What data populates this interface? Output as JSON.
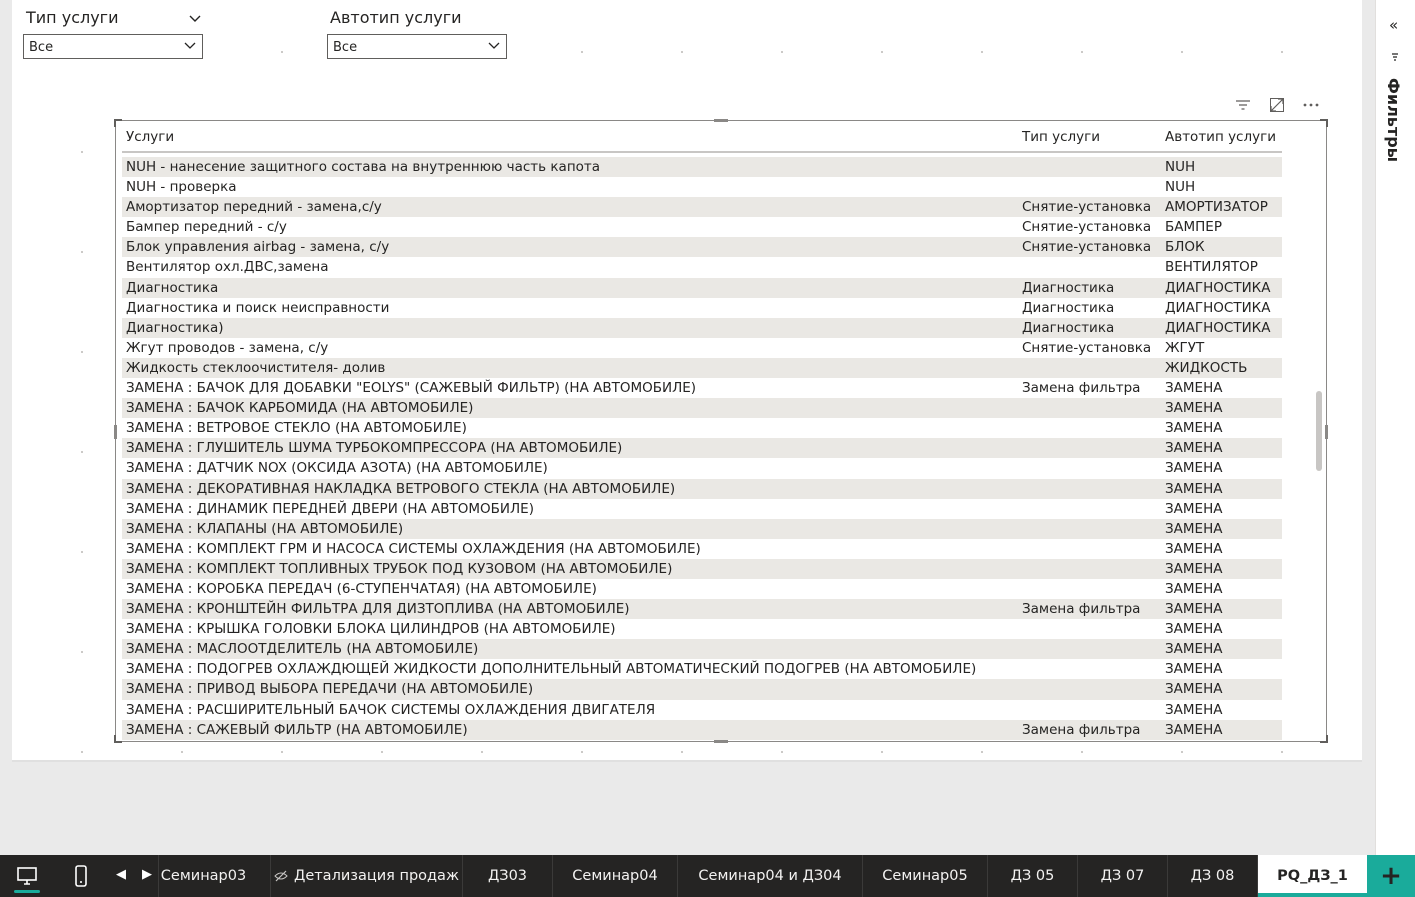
{
  "slicers": [
    {
      "title": "Тип услуги",
      "value": "Все"
    },
    {
      "title": "Автотип услуги",
      "value": "Все"
    }
  ],
  "table": {
    "headers": [
      "Услуги",
      "Тип услуги",
      "Автотип услуги"
    ],
    "rows": [
      [
        "NUH - нанесение защитного состава на внутреннюю часть капота",
        "",
        "NUH"
      ],
      [
        "NUH - проверка",
        "",
        "NUH"
      ],
      [
        "Амортизатор передний - замена,с/у",
        "Снятие-установка",
        "АМОРТИЗАТОР"
      ],
      [
        "Бампер передний - с/у",
        "Снятие-установка",
        "БАМПЕР"
      ],
      [
        "Блок управления airbag - замена, с/у",
        "Снятие-установка",
        "БЛОК"
      ],
      [
        "Вентилятор охл.ДВС,замена",
        "",
        "ВЕНТИЛЯТОР"
      ],
      [
        "Диагностика",
        "Диагностика",
        "ДИАГНОСТИКА"
      ],
      [
        "Диагностика и поиск неисправности",
        "Диагностика",
        "ДИАГНОСТИКА"
      ],
      [
        "Диагностика)",
        "Диагностика",
        "ДИАГНОСТИКА"
      ],
      [
        "Жгут проводов - замена, с/у",
        "Снятие-установка",
        "ЖГУТ"
      ],
      [
        "Жидкость стеклоочистителя- долив",
        "",
        "ЖИДКОСТЬ"
      ],
      [
        "ЗАМЕНА : БАЧОК ДЛЯ ДОБАВКИ \"EOLYS\" (САЖЕВЫЙ ФИЛЬТР) (НА АВТОМОБИЛЕ)",
        "Замена фильтра",
        "ЗАМЕНА"
      ],
      [
        "ЗАМЕНА : БАЧОК КАРБОМИДА (НА АВТОМОБИЛЕ)",
        "",
        "ЗАМЕНА"
      ],
      [
        "ЗАМЕНА : ВЕТРОВОЕ СТЕКЛО (НА АВТОМОБИЛЕ)",
        "",
        "ЗАМЕНА"
      ],
      [
        "ЗАМЕНА : ГЛУШИТЕЛЬ ШУМА ТУРБОКОМПРЕССОРА (НА АВТОМОБИЛЕ)",
        "",
        "ЗАМЕНА"
      ],
      [
        "ЗАМЕНА : ДАТЧИК NOX (ОКСИДА АЗОТА) (НА АВТОМОБИЛЕ)",
        "",
        "ЗАМЕНА"
      ],
      [
        "ЗАМЕНА : ДЕКОРАТИВНАЯ НАКЛАДКА ВЕТРОВОГО СТЕКЛА (НА АВТОМОБИЛЕ)",
        "",
        "ЗАМЕНА"
      ],
      [
        "ЗАМЕНА : ДИНАМИК ПЕРЕДНЕЙ ДВЕРИ (НА АВТОМОБИЛЕ)",
        "",
        "ЗАМЕНА"
      ],
      [
        "ЗАМЕНА : КЛАПАНЫ (НА АВТОМОБИЛЕ)",
        "",
        "ЗАМЕНА"
      ],
      [
        "ЗАМЕНА : КОМПЛЕКТ ГРМ И НАСОСА СИСТЕМЫ ОХЛАЖДЕНИЯ (НА АВТОМОБИЛЕ)",
        "",
        "ЗАМЕНА"
      ],
      [
        "ЗАМЕНА : КОМПЛЕКТ ТОПЛИВНЫХ ТРУБОК ПОД КУЗОВОМ (НА АВТОМОБИЛЕ)",
        "",
        "ЗАМЕНА"
      ],
      [
        "ЗАМЕНА : КОРОБКА ПЕРЕДАЧ (6-СТУПЕНЧАТАЯ) (НА АВТОМОБИЛЕ)",
        "",
        "ЗАМЕНА"
      ],
      [
        "ЗАМЕНА : КРОНШТЕЙН ФИЛЬТРА ДЛЯ ДИЗТОПЛИВА (НА АВТОМОБИЛЕ)",
        "Замена фильтра",
        "ЗАМЕНА"
      ],
      [
        "ЗАМЕНА : КРЫШКА ГОЛОВКИ БЛОКА ЦИЛИНДРОВ (НА АВТОМОБИЛЕ)",
        "",
        "ЗАМЕНА"
      ],
      [
        "ЗАМЕНА : МАСЛООТДЕЛИТЕЛЬ (НА АВТОМОБИЛЕ)",
        "",
        "ЗАМЕНА"
      ],
      [
        "ЗАМЕНА : ПОДОГРЕВ ОХЛАЖДЮЩЕЙ ЖИДКОСТИ ДОПОЛНИТЕЛЬНЫЙ АВТОМАТИЧЕСКИЙ ПОДОГРЕВ (НА АВТОМОБИЛЕ)",
        "",
        "ЗАМЕНА"
      ],
      [
        "ЗАМЕНА : ПРИВОД ВЫБОРА ПЕРЕДАЧИ (НА АВТОМОБИЛЕ)",
        "",
        "ЗАМЕНА"
      ],
      [
        "ЗАМЕНА : РАСШИРИТЕЛЬНЫЙ БАЧОК СИСТЕМЫ ОХЛАЖДЕНИЯ ДВИГАТЕЛЯ",
        "",
        "ЗАМЕНА"
      ],
      [
        "ЗАМЕНА : САЖЕВЫЙ ФИЛЬТР (НА АВТОМОБИЛЕ)",
        "Замена фильтра",
        "ЗАМЕНА"
      ]
    ]
  },
  "filters_pane": {
    "label": "Фильтры"
  },
  "tabs": [
    {
      "label": "Семинар03",
      "active": false
    },
    {
      "label": "Детализация продаж",
      "active": false,
      "hidden_icon": true
    },
    {
      "label": "ДЗ03",
      "active": false
    },
    {
      "label": "Семинар04",
      "active": false
    },
    {
      "label": "Семинар04 и ДЗ04",
      "active": false
    },
    {
      "label": "Семинар05",
      "active": false
    },
    {
      "label": "ДЗ 05",
      "active": false
    },
    {
      "label": "ДЗ 07",
      "active": false
    },
    {
      "label": "ДЗ 08",
      "active": false
    },
    {
      "label": "PQ_ДЗ_1",
      "active": true
    }
  ],
  "colors": {
    "accent": "#1aab9b",
    "bar": "#252423",
    "row_alt": "#eae8e4"
  }
}
